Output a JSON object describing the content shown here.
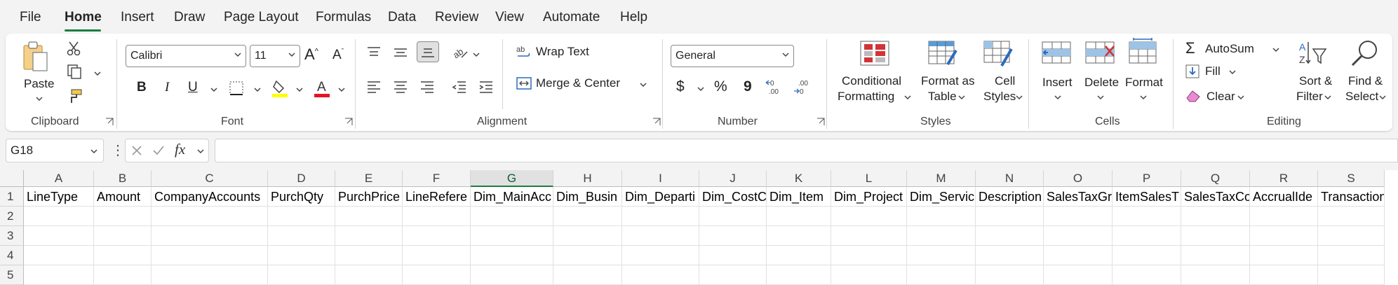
{
  "tabs": [
    "File",
    "Home",
    "Insert",
    "Draw",
    "Page Layout",
    "Formulas",
    "Data",
    "Review",
    "View",
    "Automate",
    "Help"
  ],
  "active_tab": "Home",
  "clipboard": {
    "paste": "Paste",
    "group": "Clipboard"
  },
  "font": {
    "name": "Calibri",
    "size": "11",
    "group": "Font"
  },
  "alignment": {
    "wrap": "Wrap Text",
    "merge": "Merge & Center",
    "group": "Alignment"
  },
  "number": {
    "format": "General",
    "group": "Number",
    "currency": "$",
    "percent": "%",
    "comma": "9"
  },
  "styles": {
    "conditional": [
      "Conditional",
      "Formatting"
    ],
    "table": [
      "Format as",
      "Table"
    ],
    "cell": [
      "Cell",
      "Styles"
    ],
    "group": "Styles"
  },
  "cells": {
    "insert": "Insert",
    "delete": "Delete",
    "format": "Format",
    "group": "Cells"
  },
  "editing": {
    "autosum": "AutoSum",
    "fill": "Fill",
    "clear": "Clear",
    "sort": [
      "Sort &",
      "Filter"
    ],
    "find": [
      "Find &",
      "Select"
    ],
    "group": "Editing"
  },
  "namebox": "G18",
  "fx": "fx",
  "columns": [
    "A",
    "B",
    "C",
    "D",
    "E",
    "F",
    "G",
    "H",
    "I",
    "J",
    "K",
    "L",
    "M",
    "N",
    "O",
    "P",
    "Q",
    "R",
    "S"
  ],
  "selected_column": "G",
  "rows": [
    "1",
    "2",
    "3",
    "4",
    "5"
  ],
  "row1": [
    "LineType",
    "Amount",
    "CompanyAccounts",
    "PurchQty",
    "PurchPrice",
    "LineRefere",
    "Dim_MainAcc",
    "Dim_Busin",
    "Dim_Departi",
    "Dim_CostC",
    "Dim_Item",
    "Dim_Project",
    "Dim_Servic",
    "Description",
    "SalesTaxGr",
    "ItemSalesT",
    "SalesTaxCo",
    "AccrualIde",
    "TransactionC"
  ]
}
